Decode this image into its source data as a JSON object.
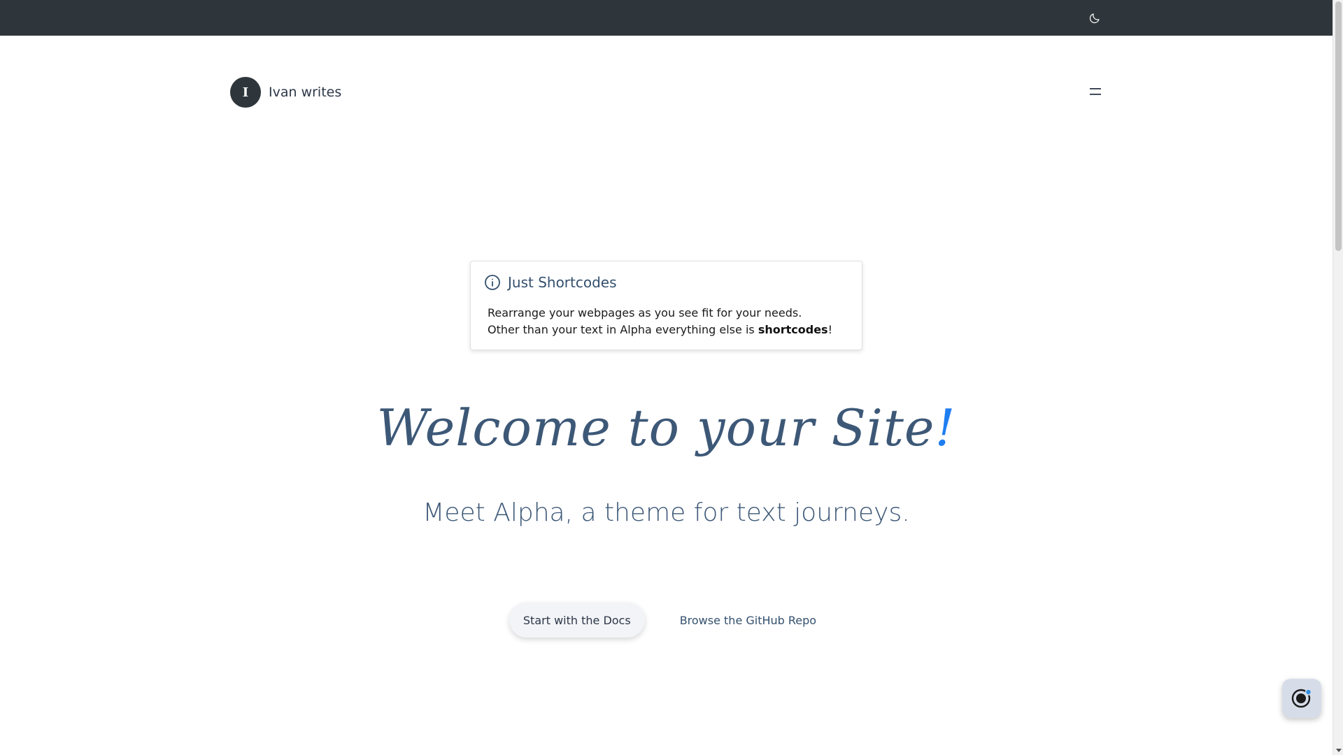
{
  "topbar": {
    "theme_toggle_icon": "moon-icon"
  },
  "header": {
    "avatar_letter": "I",
    "site_name": "Ivan writes",
    "menu_icon": "hamburger-menu-icon"
  },
  "notice": {
    "icon": "info-circle-icon",
    "title": "Just Shortcodes",
    "line1": "Rearrange your webpages as you see fit for your needs.",
    "line2_prefix": "Other than your text in Alpha everything else is ",
    "line2_strong": "shortcodes",
    "line2_suffix": "!"
  },
  "hero": {
    "title_main": "Welcome to your Site",
    "title_accent": "!",
    "subtitle": "Meet Alpha, a theme for text journeys."
  },
  "cta": {
    "primary_label": "Start with the Docs",
    "secondary_label": "Browse the GitHub Repo"
  },
  "fab": {
    "icon": "assistant-ring-icon"
  },
  "colors": {
    "topbar": "#2e363b",
    "heading": "#3d5877",
    "accent": "#1f7ef0",
    "fab_bg": "#d7dde8"
  }
}
